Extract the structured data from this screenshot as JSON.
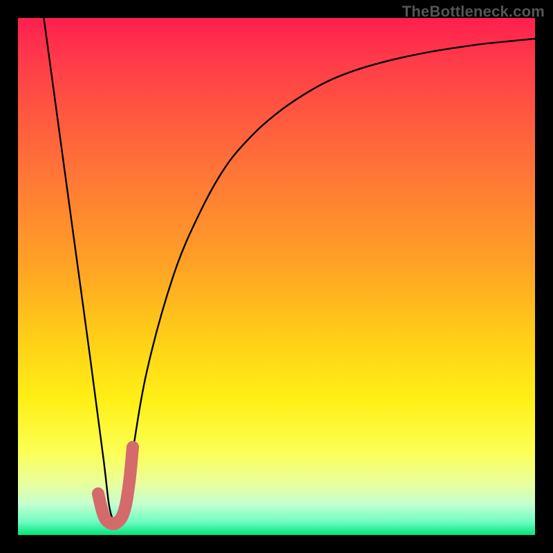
{
  "watermark": "TheBottleneck.com",
  "colors": {
    "frame": "#000000",
    "curve_thin": "#000000",
    "curve_thick": "#d46a6a",
    "gradient_top": "#ff1f4e",
    "gradient_bottom": "#00e47b"
  },
  "chart_data": {
    "type": "line",
    "title": "",
    "xlabel": "",
    "ylabel": "",
    "xlim": [
      0,
      100
    ],
    "ylim": [
      0,
      100
    ],
    "grid": false,
    "legend": false,
    "series": [
      {
        "name": "bottleneck-curve",
        "style": "thin-black",
        "x": [
          5,
          8,
          11,
          14,
          16.5,
          18,
          20,
          22,
          25,
          30,
          35,
          40,
          45,
          50,
          55,
          60,
          65,
          70,
          75,
          80,
          85,
          90,
          95,
          100
        ],
        "y": [
          100,
          78,
          56,
          34,
          15,
          4,
          3,
          15,
          32,
          50,
          62,
          71,
          77,
          81.5,
          85,
          87.8,
          89.8,
          91.3,
          92.5,
          93.5,
          94.3,
          95,
          95.5,
          96
        ]
      },
      {
        "name": "optimal-marker",
        "style": "thick-red-J",
        "x": [
          15.5,
          16.5,
          17.5,
          19,
          20.5,
          21.5,
          22.2
        ],
        "y": [
          8,
          4,
          2.5,
          2.3,
          4.5,
          10,
          17
        ]
      }
    ]
  }
}
